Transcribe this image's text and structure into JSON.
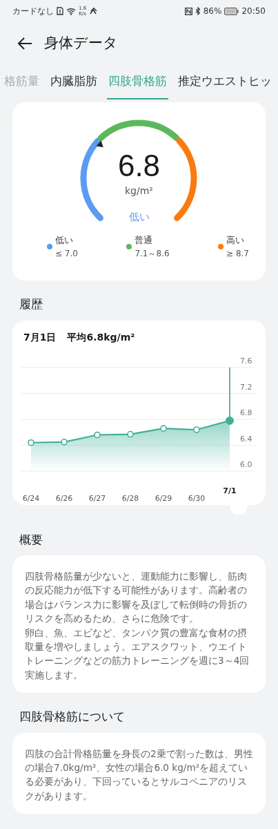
{
  "status_bar": {
    "carrier": "カードなし",
    "speed_value": "1.6",
    "speed_unit": "K/s",
    "battery": "86%",
    "time": "20:50"
  },
  "header": {
    "title": "身体データ"
  },
  "tabs": [
    {
      "label": "格筋量",
      "selected": false
    },
    {
      "label": "内臓脂肪",
      "selected": false
    },
    {
      "label": "四肢骨格筋",
      "selected": true
    },
    {
      "label": "推定ウエストヒッ",
      "selected": false
    }
  ],
  "gauge": {
    "value": "6.8",
    "unit": "kg/m²",
    "status": "低い",
    "legend": [
      {
        "label": "低い",
        "range": "≤ 7.0",
        "color": "#5b9cf2"
      },
      {
        "label": "普通",
        "range": "7.1～8.6",
        "color": "#5cb85c"
      },
      {
        "label": "高い",
        "range": "≥ 8.7",
        "color": "#fa7a10"
      }
    ]
  },
  "history": {
    "heading": "履歴",
    "date": "7月1日",
    "average": "平均6.8kg/m²",
    "chart_data": {
      "type": "area",
      "categories": [
        "6/24",
        "6/26",
        "6/27",
        "6/28",
        "6/29",
        "6/30",
        "7/1"
      ],
      "values": [
        6.44,
        6.45,
        6.56,
        6.57,
        6.66,
        6.64,
        6.78
      ],
      "ylim": [
        6.0,
        7.6
      ],
      "yticks": [
        {
          "value": 6.0,
          "label": "6.0"
        },
        {
          "value": 6.4,
          "label": "6.4"
        },
        {
          "value": 6.8,
          "label": "6.8"
        },
        {
          "value": 7.2,
          "label": "7.2"
        },
        {
          "value": 7.6,
          "label": "7.6"
        }
      ],
      "grid": true
    }
  },
  "sections": [
    {
      "heading": "概要",
      "paragraphs": [
        "四肢骨格筋量が少ないと、運動能力に影響し、筋肉の反応能力が低下する可能性があります。高齢者の場合はバランス力に影響を及ぼして転倒時の骨折のリスクを高めるため、さらに危険です。",
        "卵白、魚、エビなど、タンパク質の豊富な食材の摂取量を増やしましょう。エアスクワット、ウエイトトレーニングなどの筋力トレーニングを週に3～4回実施します。"
      ]
    },
    {
      "heading": "四肢骨格筋について",
      "paragraphs": [
        "四肢の合計骨格筋量を身長の2乗で割った数は、男性の場合7.0kg/m²、女性の場合6.0 kg/m²を超えている必要があり、下回っているとサルコペニアのリスクがあります。"
      ]
    }
  ]
}
